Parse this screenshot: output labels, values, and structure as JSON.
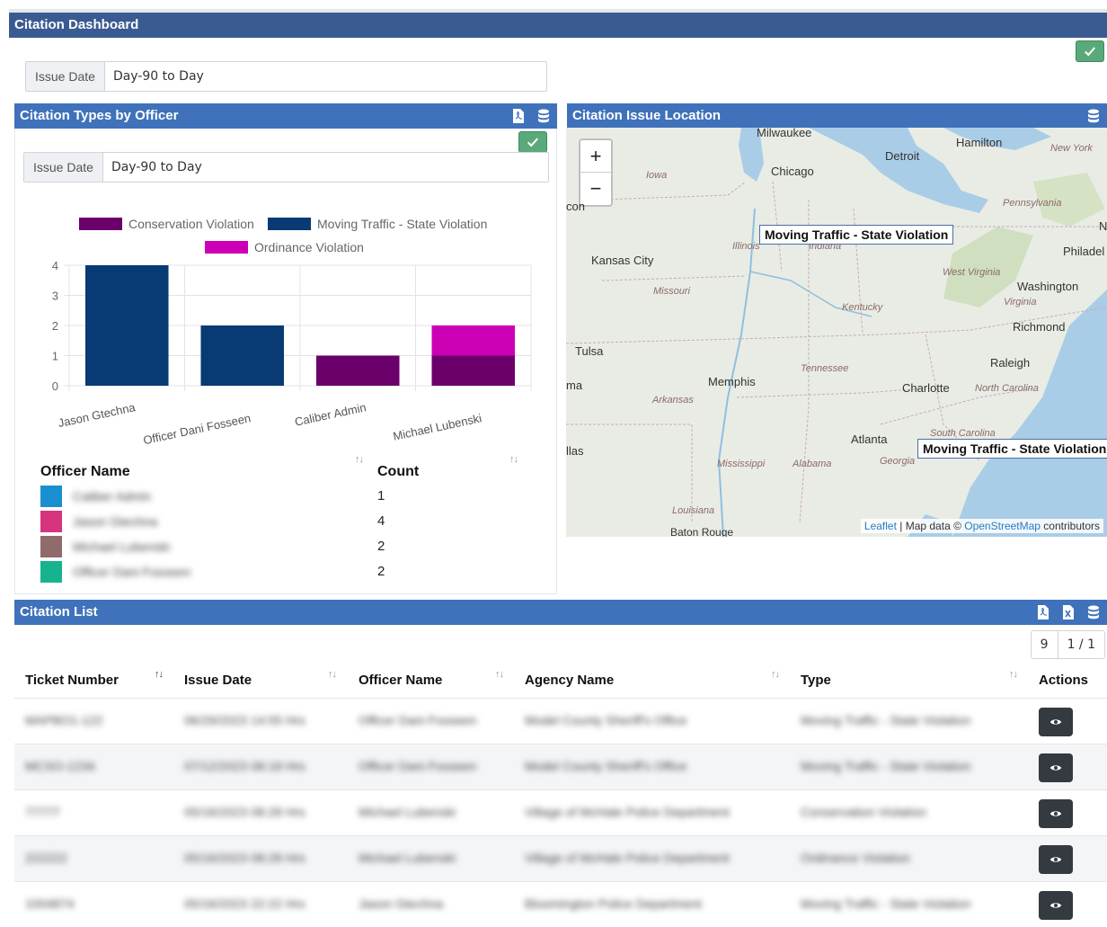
{
  "app": {
    "title": "Citation Dashboard"
  },
  "top_filter": {
    "label": "Issue Date",
    "value": "Day-90 to Day"
  },
  "types_panel": {
    "title": "Citation Types by Officer",
    "filter": {
      "label": "Issue Date",
      "value": "Day-90 to Day"
    },
    "officer_table": {
      "headers": [
        "Officer Name",
        "Count"
      ],
      "rows": [
        {
          "name": "Caliber Admin",
          "count": "1",
          "color": "#1a8fd0"
        },
        {
          "name": "Jason Gtechna",
          "count": "4",
          "color": "#d6347e"
        },
        {
          "name": "Michael Lubenski",
          "count": "2",
          "color": "#8f6b6b"
        },
        {
          "name": "Officer Dani Fosseen",
          "count": "2",
          "color": "#17b38e"
        }
      ]
    }
  },
  "chart_data": {
    "type": "bar",
    "stacked": true,
    "categories": [
      "Jason Gtechna",
      "Officer Dani Fosseen",
      "Caliber Admin",
      "Michael Lubenski"
    ],
    "series": [
      {
        "name": "Conservation Violation",
        "color": "#6b006b",
        "values": [
          0,
          0,
          1,
          1
        ]
      },
      {
        "name": "Moving Traffic - State Violation",
        "color": "#083a73",
        "values": [
          4,
          2,
          0,
          0
        ]
      },
      {
        "name": "Ordinance Violation",
        "color": "#cc00b4",
        "values": [
          0,
          0,
          0,
          1
        ]
      }
    ],
    "yticks": [
      "0",
      "1",
      "2",
      "3",
      "4"
    ],
    "ylim": [
      0,
      4
    ],
    "grid": true,
    "legend_position": "top"
  },
  "location_panel": {
    "title": "Citation Issue Location",
    "map": {
      "zoom_in": "+",
      "zoom_out": "−",
      "cities": [
        "Milwaukee",
        "Hamilton",
        "Detroit",
        "Chicago",
        "Kansas City",
        "Philadel",
        "Washington",
        "Richmond",
        "Tulsa",
        "Memphis",
        "Raleigh",
        "Charlotte",
        "Atlanta",
        "llas",
        "ma",
        "con",
        "N"
      ],
      "states": [
        "Iowa",
        "New York",
        "Pennsylvania",
        "Illinois",
        "Indiana",
        "Missouri",
        "West Virginia",
        "Virginia",
        "Kentucky",
        "Tennessee",
        "North Carolina",
        "Arkansas",
        "South Carolina",
        "Georgia",
        "Mississippi",
        "Alabama",
        "Louisiana",
        "Baton Rouge"
      ],
      "markers": [
        "Moving Traffic - State Violation",
        "Moving Traffic - State Violation"
      ],
      "attribution": {
        "leaflet": "Leaflet",
        "sep": " | Map data © ",
        "osm": "OpenStreetMap",
        "tail": " contributors"
      }
    }
  },
  "citation_list": {
    "title": "Citation List",
    "pager": {
      "count": "9",
      "pages": "1 / 1"
    },
    "headers": [
      "Ticket Number",
      "Issue Date",
      "Officer Name",
      "Agency Name",
      "Type",
      "Actions"
    ],
    "rows": [
      {
        "ticket": "MAPBO1-122",
        "date": "06/29/2023 14:55 Hrs",
        "officer": "Officer Dani Fosseen",
        "agency": "Model County Sheriff's Office",
        "type": "Moving Traffic - State Violation"
      },
      {
        "ticket": "MCSO-1234",
        "date": "07/12/2023 08:18 Hrs",
        "officer": "Officer Dani Fosseen",
        "agency": "Model County Sheriff's Office",
        "type": "Moving Traffic - State Violation"
      },
      {
        "ticket": "77777",
        "date": "05/16/2023 08:28 Hrs",
        "officer": "Michael Lubenski",
        "agency": "Village of McHale Police Department",
        "type": "Conservation Violation"
      },
      {
        "ticket": "222222",
        "date": "05/16/2023 08:28 Hrs",
        "officer": "Michael Lubenski",
        "agency": "Village of McHale Police Department",
        "type": "Ordinance Violation"
      },
      {
        "ticket": "1004874",
        "date": "05/16/2023 22:22 Hrs",
        "officer": "Jason Gtechna",
        "agency": "Bloomington Police Department",
        "type": "Moving Traffic - State Violation"
      }
    ]
  },
  "colors": {
    "titlebar": "#3a5a92",
    "panel_header": "#3f72bb",
    "accent_green": "#5aa97a"
  }
}
